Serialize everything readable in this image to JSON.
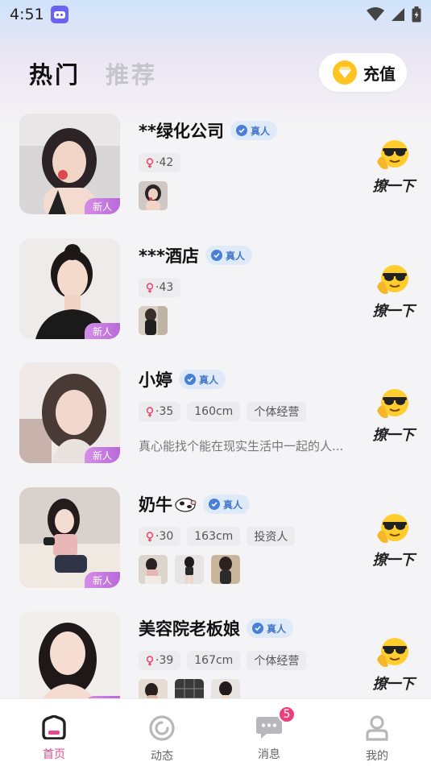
{
  "status_bar": {
    "time": "4:51"
  },
  "header": {
    "tabs": [
      {
        "label": "热门"
      },
      {
        "label": "推荐"
      }
    ],
    "recharge_label": "充值"
  },
  "cards": [
    {
      "name": "**绿化公司",
      "verified_label": "真人",
      "age": "·42",
      "tags": [],
      "bio": "",
      "new_label": "新人",
      "photo_count": 1,
      "action_label": "撩一下"
    },
    {
      "name": "***酒店",
      "verified_label": "真人",
      "age": "·43",
      "tags": [],
      "bio": "",
      "new_label": "新人",
      "photo_count": 1,
      "action_label": "撩一下"
    },
    {
      "name": "小婷",
      "verified_label": "真人",
      "age": "·35",
      "tags": [
        "160cm",
        "个体经营"
      ],
      "bio": "真心能找个能在现实生活中一起的人...",
      "new_label": "新人",
      "photo_count": 0,
      "action_label": "撩一下"
    },
    {
      "name": "奶牛",
      "verified_label": "真人",
      "age": "·30",
      "tags": [
        "163cm",
        "投资人"
      ],
      "bio": "",
      "new_label": "新人",
      "photo_count": 3,
      "action_label": "撩一下"
    },
    {
      "name": "美容院老板娘",
      "verified_label": "真人",
      "age": "·39",
      "tags": [
        "167cm",
        "个体经营"
      ],
      "bio": "",
      "new_label": "新人",
      "photo_count": 3,
      "action_label": "撩一下"
    }
  ],
  "tabbar": {
    "items": [
      {
        "label": "首页",
        "icon": "home-icon",
        "active": true
      },
      {
        "label": "动态",
        "icon": "moments-icon"
      },
      {
        "label": "消息",
        "icon": "message-icon",
        "badge": "5"
      },
      {
        "label": "我的",
        "icon": "profile-icon"
      }
    ]
  },
  "colors": {
    "accent": "#e34c8f",
    "verify": "#4a7fd6",
    "new_tag": "#c47be0",
    "recharge_icon": "#ffc322"
  }
}
